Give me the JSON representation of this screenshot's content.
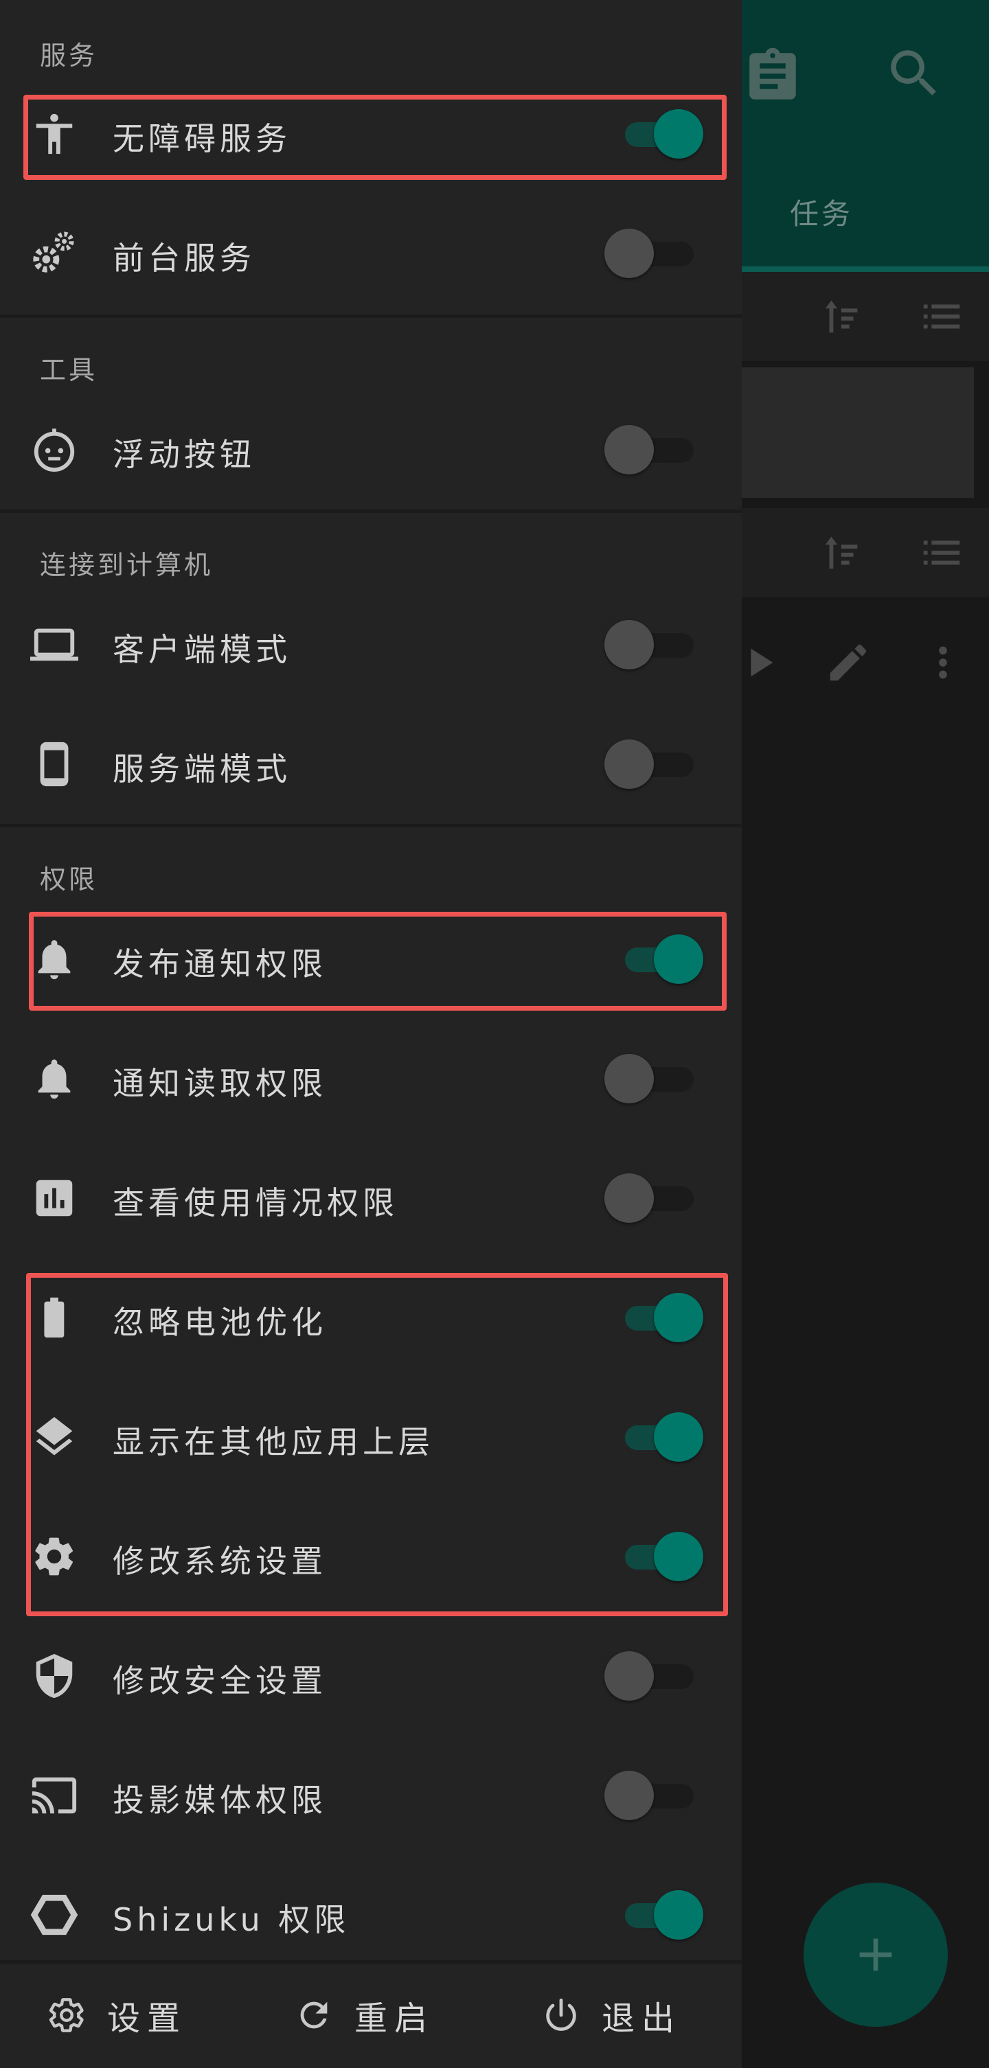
{
  "background_app": {
    "header_icons": [
      "clipboard-icon",
      "search-icon"
    ],
    "tab_label": "任务",
    "fab_icon": "plus-icon"
  },
  "drawer": {
    "sections": [
      {
        "title": "服务",
        "items": [
          {
            "icon": "accessibility-icon",
            "label": "无障碍服务",
            "enabled": true,
            "highlighted": true
          },
          {
            "icon": "gears-icon",
            "label": "前台服务",
            "enabled": false
          }
        ]
      },
      {
        "title": "工具",
        "items": [
          {
            "icon": "floating-button-icon",
            "label": "浮动按钮",
            "enabled": false
          }
        ]
      },
      {
        "title": "连接到计算机",
        "items": [
          {
            "icon": "laptop-icon",
            "label": "客户端模式",
            "enabled": false
          },
          {
            "icon": "phone-icon",
            "label": "服务端模式",
            "enabled": false
          }
        ]
      },
      {
        "title": "权限",
        "items": [
          {
            "icon": "bell-icon",
            "label": "发布通知权限",
            "enabled": true,
            "highlighted": true
          },
          {
            "icon": "bell-icon",
            "label": "通知读取权限",
            "enabled": false
          },
          {
            "icon": "bar-chart-icon",
            "label": "查看使用情况权限",
            "enabled": false
          },
          {
            "icon": "battery-icon",
            "label": "忽略电池优化",
            "enabled": true,
            "highlighted": true
          },
          {
            "icon": "layers-icon",
            "label": "显示在其他应用上层",
            "enabled": true,
            "highlighted": true
          },
          {
            "icon": "gear-icon",
            "label": "修改系统设置",
            "enabled": true,
            "highlighted": true
          },
          {
            "icon": "shield-icon",
            "label": "修改安全设置",
            "enabled": false
          },
          {
            "icon": "cast-icon",
            "label": "投影媒体权限",
            "enabled": false
          },
          {
            "icon": "hexagon-icon",
            "label": "Shizuku 权限",
            "enabled": true
          }
        ]
      }
    ],
    "footer": [
      {
        "icon": "settings-outline-icon",
        "label": "设置"
      },
      {
        "icon": "refresh-icon",
        "label": "重启"
      },
      {
        "icon": "power-icon",
        "label": "退出"
      }
    ]
  },
  "colors": {
    "drawer_bg": "#232323",
    "accent": "#00796b",
    "highlight_border": "#ee5552"
  }
}
